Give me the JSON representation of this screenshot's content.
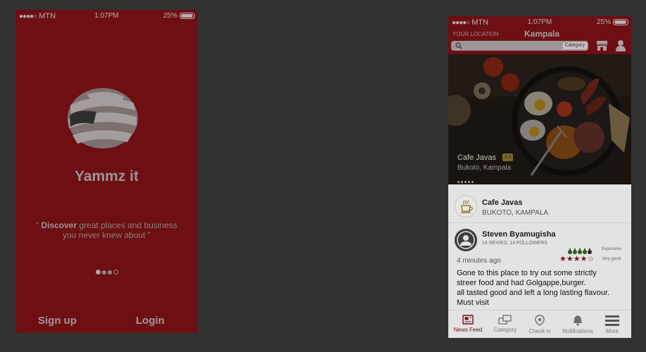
{
  "status_bar": {
    "carrier": "MTN",
    "time": "1:07PM",
    "battery": "25%"
  },
  "splash": {
    "brand": "Yammz it",
    "tagline_quote_open": "“",
    "tagline_bold": "Discover",
    "tagline_rest": " great places and business",
    "tagline_line2": "you never knew about ”",
    "signup_label": "Sign up",
    "login_label": "Login"
  },
  "feed": {
    "location_label": "YOUR LOCATION",
    "location_city": "Kampala",
    "search_category_label": "Category",
    "hero": {
      "title": "Cafe Javas",
      "badge": "4.0",
      "subtitle": "Bukoto, Kampala"
    },
    "place": {
      "name": "Cafe Javas",
      "location": "BUKOTO, KAMPALA"
    },
    "review": {
      "author": "Steven Byamugisha",
      "meta": "14 REVIES, 14 FOLLOWERS",
      "price_label": "Expensive",
      "rating_label": "Very good",
      "time": "4 minutes ago",
      "body_line1": "Gone to this place to try out some strictly",
      "body_line2": "streer food and had Golgappe,burger.",
      "body_line3": "all tasted good and left a long lasting flavour.",
      "body_line4": "Must visit",
      "stars": 4,
      "max_stars": 5
    },
    "tabs": [
      {
        "label": "News Feed",
        "icon": "news-feed-icon",
        "active": true
      },
      {
        "label": "Category",
        "icon": "category-icon",
        "active": false
      },
      {
        "label": "Check in",
        "icon": "location-pin-icon",
        "active": false
      },
      {
        "label": "Notifications",
        "icon": "bell-icon",
        "active": false
      },
      {
        "label": "More",
        "icon": "hamburger-icon",
        "active": false
      }
    ]
  },
  "colors": {
    "brand_red": "#6d0f13",
    "background": "#323232"
  }
}
